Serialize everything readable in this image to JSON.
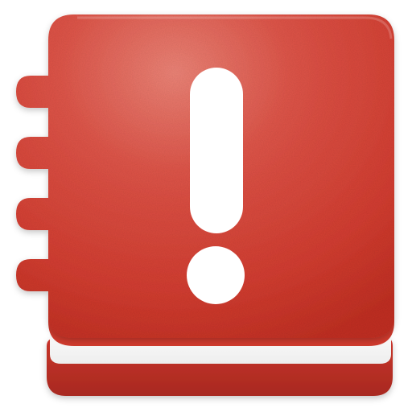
{
  "icon": {
    "name": "reminder-notebook-icon",
    "colors": {
      "cover_top": "#e05448",
      "cover_mid": "#d43d30",
      "cover_bottom": "#c22f23",
      "back_cover": "#c9342a",
      "back_cover_dark": "#a82a21",
      "pages": "#ffffff",
      "highlight": "#ee8477",
      "mark": "#ffffff"
    }
  }
}
